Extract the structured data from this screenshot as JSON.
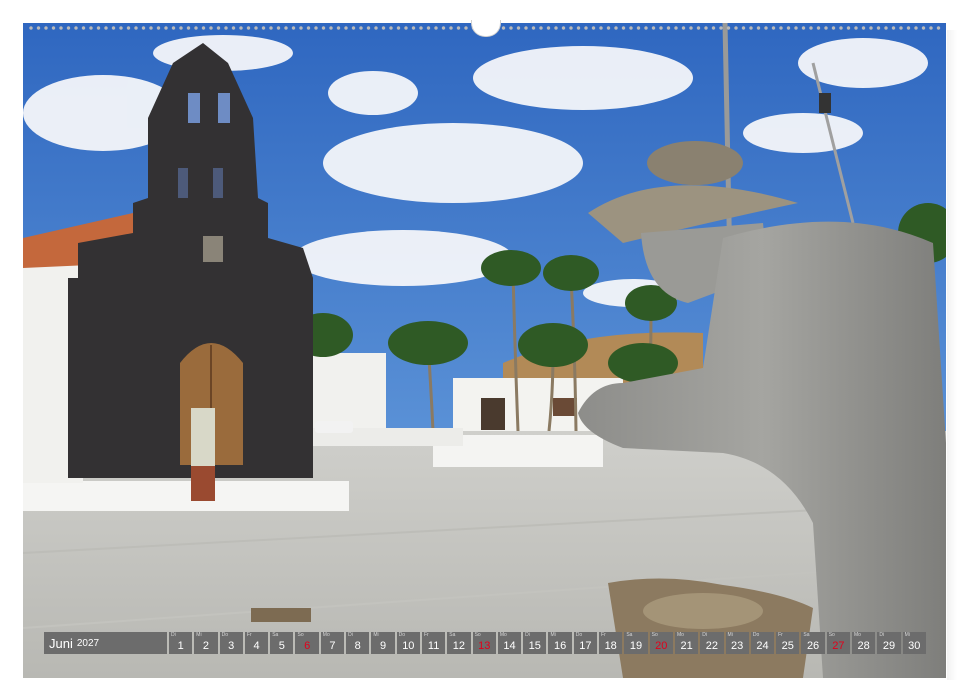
{
  "calendar": {
    "month": "Juni",
    "year": "2027",
    "days": [
      {
        "weekday": "Di",
        "day": "1",
        "sunday": false
      },
      {
        "weekday": "Mi",
        "day": "2",
        "sunday": false
      },
      {
        "weekday": "Do",
        "day": "3",
        "sunday": false
      },
      {
        "weekday": "Fr",
        "day": "4",
        "sunday": false
      },
      {
        "weekday": "Sa",
        "day": "5",
        "sunday": false
      },
      {
        "weekday": "So",
        "day": "6",
        "sunday": true
      },
      {
        "weekday": "Mo",
        "day": "7",
        "sunday": false
      },
      {
        "weekday": "Di",
        "day": "8",
        "sunday": false
      },
      {
        "weekday": "Mi",
        "day": "9",
        "sunday": false
      },
      {
        "weekday": "Do",
        "day": "10",
        "sunday": false
      },
      {
        "weekday": "Fr",
        "day": "11",
        "sunday": false
      },
      {
        "weekday": "Sa",
        "day": "12",
        "sunday": false
      },
      {
        "weekday": "So",
        "day": "13",
        "sunday": true
      },
      {
        "weekday": "Mo",
        "day": "14",
        "sunday": false
      },
      {
        "weekday": "Di",
        "day": "15",
        "sunday": false
      },
      {
        "weekday": "Mi",
        "day": "16",
        "sunday": false
      },
      {
        "weekday": "Do",
        "day": "17",
        "sunday": false
      },
      {
        "weekday": "Fr",
        "day": "18",
        "sunday": false
      },
      {
        "weekday": "Sa",
        "day": "19",
        "sunday": false
      },
      {
        "weekday": "So",
        "day": "20",
        "sunday": true
      },
      {
        "weekday": "Mo",
        "day": "21",
        "sunday": false
      },
      {
        "weekday": "Di",
        "day": "22",
        "sunday": false
      },
      {
        "weekday": "Mi",
        "day": "23",
        "sunday": false
      },
      {
        "weekday": "Do",
        "day": "24",
        "sunday": false
      },
      {
        "weekday": "Fr",
        "day": "25",
        "sunday": false
      },
      {
        "weekday": "Sa",
        "day": "26",
        "sunday": false
      },
      {
        "weekday": "So",
        "day": "27",
        "sunday": true
      },
      {
        "weekday": "Mo",
        "day": "28",
        "sunday": false
      },
      {
        "weekday": "Di",
        "day": "29",
        "sunday": false
      },
      {
        "weekday": "Mi",
        "day": "30",
        "sunday": false
      }
    ]
  },
  "colors": {
    "bar_background": "#6c6c6c",
    "sunday_text": "#e3001b",
    "sky": "#3f78c8"
  }
}
